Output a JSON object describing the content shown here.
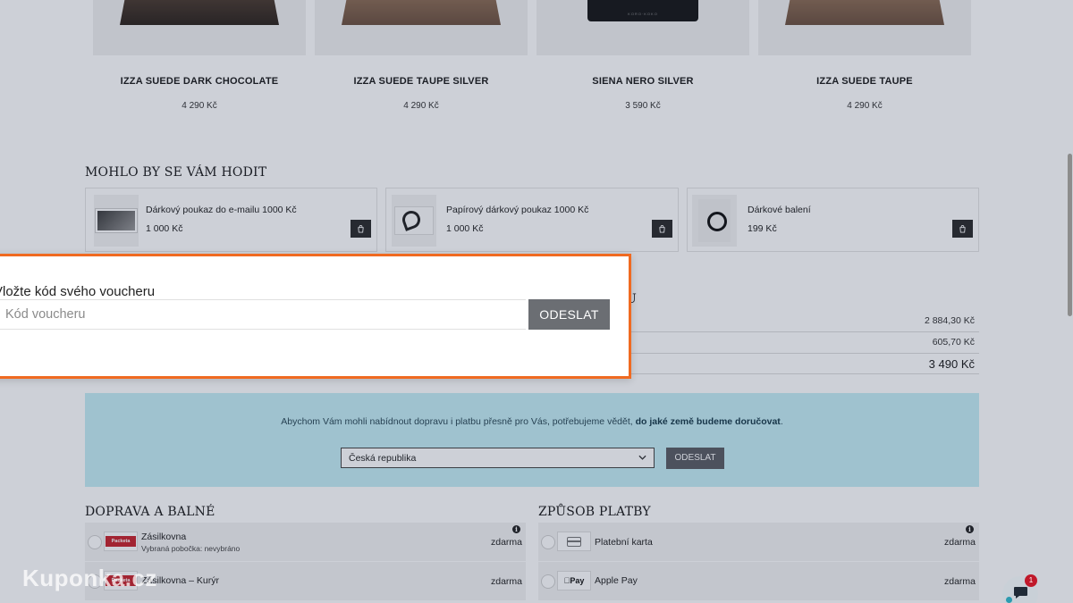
{
  "products": [
    {
      "name": "IZZA SUEDE DARK CHOCOLATE",
      "price": "4 290 Kč",
      "variant": "dark"
    },
    {
      "name": "IZZA SUEDE TAUPE SILVER",
      "price": "4 290 Kč",
      "variant": "taupe"
    },
    {
      "name": "SIENA NERO SILVER",
      "price": "3 590 Kč",
      "variant": "nero",
      "logo_text": "KORO·KOKO"
    },
    {
      "name": "IZZA SUEDE TAUPE",
      "price": "4 290 Kč",
      "variant": "taupe"
    }
  ],
  "upsell": {
    "title": "MOHLO BY SE VÁM HODIT",
    "items": [
      {
        "name": "Dárkový poukaz do e-mailu 1000 Kč",
        "price": "1 000 Kč",
        "icon": "cart-icon"
      },
      {
        "name": "Papírový dárkový poukaz 1000 Kč",
        "price": "1 000 Kč",
        "icon": "cart-icon"
      },
      {
        "name": "Dárkové balení",
        "price": "199 Kč",
        "icon": "cart-icon"
      }
    ]
  },
  "summary": {
    "title_fragment": "U",
    "rows": [
      {
        "value": "2 884,30 Kč"
      },
      {
        "value": "605,70 Kč"
      },
      {
        "value": "3 490 Kč"
      }
    ]
  },
  "country": {
    "text_before": "Abychom Vám mohli nabídnout dopravu i platbu přesně pro Vás, potřebujeme vědět, ",
    "text_bold": "do jaké země budeme doručovat",
    "text_after": ".",
    "selected": "Česká republika",
    "submit_label": "ODESLAT",
    "bg_color": "#c5edf5"
  },
  "shipping": {
    "title": "DOPRAVA A BALNÉ",
    "options": [
      {
        "name": "Zásilkovna",
        "sub": "Vybraná pobočka: nevybráno",
        "price": "zdarma",
        "logo": "Packeta"
      },
      {
        "name": "Zásilkovna – Kurýr",
        "sub": "",
        "price": "zdarma",
        "logo": "Packeta"
      }
    ]
  },
  "payment": {
    "title": "ZPŮSOB PLATBY",
    "options": [
      {
        "name": "Platební karta",
        "price": "zdarma",
        "logo": "card-icon"
      },
      {
        "name": "Apple Pay",
        "price": "zdarma",
        "logo": "Pay"
      }
    ]
  },
  "voucher_modal": {
    "label": "Vložte kód svého voucheru",
    "placeholder": "Kód voucheru",
    "submit_label": "ODESLAT",
    "border_color": "#f06a21"
  },
  "chat": {
    "badge": "1",
    "icon": "chat-icon"
  },
  "watermark": "Kuponka.cz"
}
